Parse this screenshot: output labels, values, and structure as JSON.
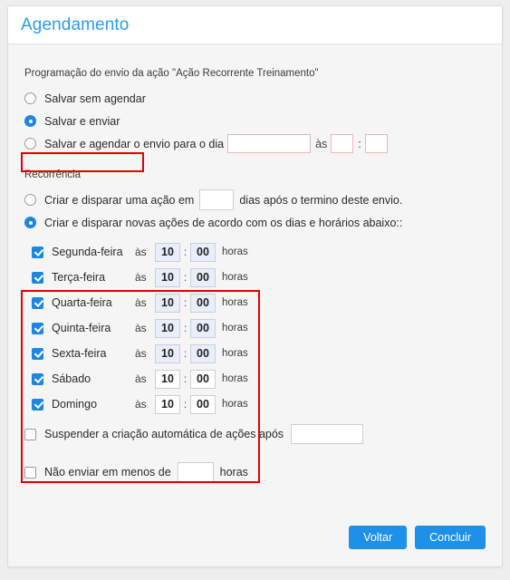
{
  "header": {
    "title": "Agendamento",
    "title_color": "#2f9ae8"
  },
  "schedule_section": {
    "label": "Programação do envio da ação \"Ação Recorrente Treinamento\"",
    "options": [
      {
        "label": "Salvar sem agendar",
        "checked": false
      },
      {
        "label": "Salvar e enviar",
        "checked": true
      },
      {
        "label": "Salvar e agendar o envio para o dia",
        "checked": false
      }
    ],
    "as_label": "às",
    "colon": ":",
    "date_value": "",
    "date_placeholder": "",
    "hour_value": "",
    "minute_value": ""
  },
  "recurrence_section": {
    "label": "Recorrência",
    "option_once": {
      "text_before": "Criar e disparar uma ação em",
      "days_value": "",
      "text_after": "dias após o termino deste envio.",
      "checked": false
    },
    "option_weekly": {
      "label": "Criar e disparar novas ações de acordo com os dias e horários abaixo::",
      "checked": true
    },
    "as_word": "às",
    "colon": ":",
    "hours_word": "horas",
    "days": [
      {
        "name": "Segunda-feira",
        "checked": true,
        "hour": "10",
        "minute": "00",
        "autofilled": true
      },
      {
        "name": "Terça-feira",
        "checked": true,
        "hour": "10",
        "minute": "00",
        "autofilled": true
      },
      {
        "name": "Quarta-feira",
        "checked": true,
        "hour": "10",
        "minute": "00",
        "autofilled": true
      },
      {
        "name": "Quinta-feira",
        "checked": true,
        "hour": "10",
        "minute": "00",
        "autofilled": true
      },
      {
        "name": "Sexta-feira",
        "checked": true,
        "hour": "10",
        "minute": "00",
        "autofilled": true
      },
      {
        "name": "Sábado",
        "checked": true,
        "hour": "10",
        "minute": "00",
        "autofilled": false
      },
      {
        "name": "Domingo",
        "checked": true,
        "hour": "10",
        "minute": "00",
        "autofilled": false
      }
    ]
  },
  "suspend_option": {
    "label": "Suspender a criação automática de ações após",
    "checked": false,
    "value": ""
  },
  "min_interval_option": {
    "text_before": "Não enviar em menos de",
    "text_after": "horas",
    "checked": false,
    "value": ""
  },
  "footer": {
    "back_label": "Voltar",
    "finish_label": "Concluir",
    "button_color": "#1e90e8"
  },
  "highlights": {
    "color": "#e60000",
    "regions": [
      "salvar-e-enviar-option",
      "weekday-schedule-block"
    ]
  }
}
